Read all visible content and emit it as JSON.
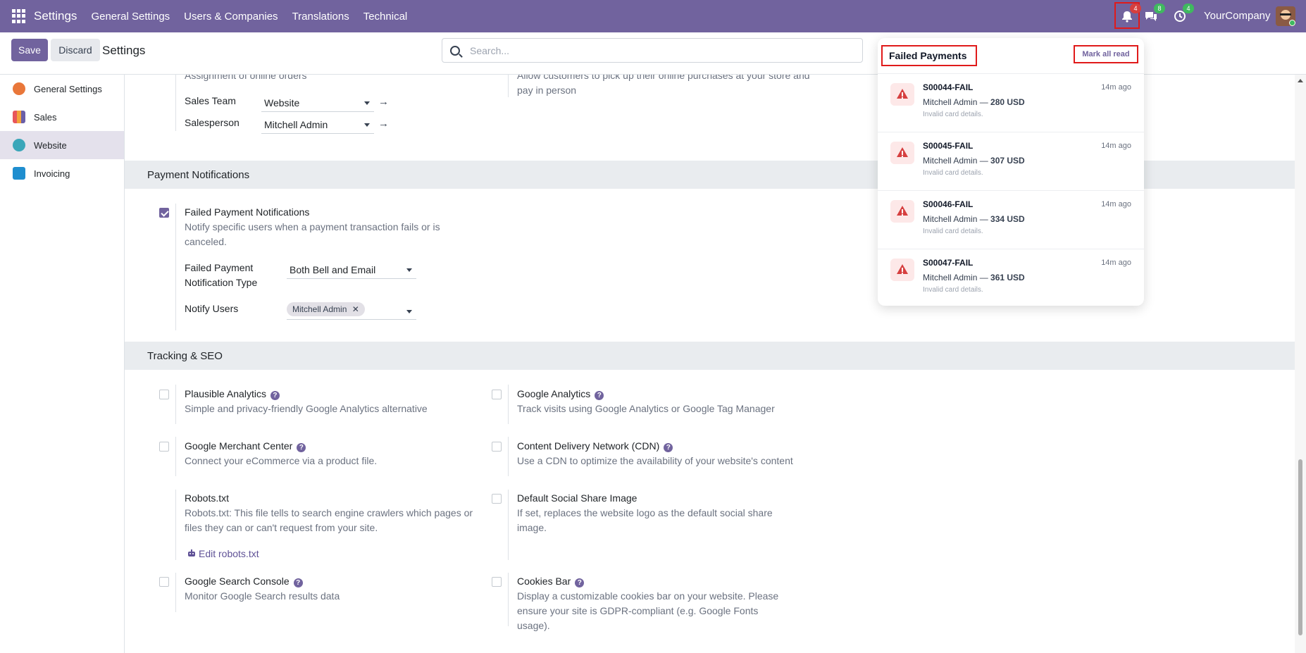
{
  "navbar": {
    "app_title": "Settings",
    "menus": [
      "General Settings",
      "Users & Companies",
      "Translations",
      "Technical"
    ],
    "bell_badge": "4",
    "chat_badge": "8",
    "activity_badge": "4",
    "company": "YourCompany"
  },
  "control": {
    "save_label": "Save",
    "discard_label": "Discard",
    "title": "Settings",
    "search_placeholder": "Search..."
  },
  "sidebar": {
    "items": [
      {
        "label": "General Settings",
        "color": "#e9773a"
      },
      {
        "label": "Sales",
        "color": "#e8565a"
      },
      {
        "label": "Website",
        "color": "#3aa6b9"
      },
      {
        "label": "Invoicing",
        "color": "#1f8ecf"
      }
    ]
  },
  "top_partial": {
    "left_desc": "Assignment of online orders",
    "right_desc": "Allow customers to pick up their online purchases at your store and pay in person",
    "sales_team_label": "Sales Team",
    "sales_team_value": "Website",
    "salesperson_label": "Salesperson",
    "salesperson_value": "Mitchell Admin"
  },
  "payment_notifications": {
    "heading": "Payment Notifications",
    "title": "Failed Payment Notifications",
    "desc": "Notify specific users when a payment transaction fails or is canceled.",
    "checked": true,
    "type_label_1": "Failed Payment",
    "type_label_2": "Notification Type",
    "type_value": "Both Bell and Email",
    "users_label": "Notify Users",
    "users_tag": "Mitchell Admin"
  },
  "tracking_seo": {
    "heading": "Tracking & SEO",
    "settings": [
      {
        "title": "Plausible Analytics",
        "desc": "Simple and privacy-friendly Google Analytics alternative"
      },
      {
        "title": "Google Analytics",
        "desc": "Track visits using Google Analytics or Google Tag Manager"
      },
      {
        "title": "Google Merchant Center",
        "desc": "Connect your eCommerce via a product file."
      },
      {
        "title": "Content Delivery Network (CDN)",
        "desc": "Use a CDN to optimize the availability of your website's content"
      },
      {
        "title": "Robots.txt",
        "desc": "Robots.txt: This file tells to search engine crawlers which pages or files they can or can't request from your site.",
        "link": "Edit robots.txt"
      },
      {
        "title": "Default Social Share Image",
        "desc": "If set, replaces the website logo as the default social share image."
      },
      {
        "title": "Google Search Console",
        "desc": "Monitor Google Search results data"
      },
      {
        "title": "Cookies Bar",
        "desc": "Display a customizable cookies bar on your website. Please ensure your site is GDPR-compliant (e.g. Google Fonts usage)."
      }
    ]
  },
  "dropdown": {
    "title": "Failed Payments",
    "mark_all": "Mark all read",
    "items": [
      {
        "ref": "S00044-FAIL",
        "time": "14m ago",
        "who": "Mitchell Admin — ",
        "amount": "280 USD",
        "reason": "Invalid card details."
      },
      {
        "ref": "S00045-FAIL",
        "time": "14m ago",
        "who": "Mitchell Admin — ",
        "amount": "307 USD",
        "reason": "Invalid card details."
      },
      {
        "ref": "S00046-FAIL",
        "time": "14m ago",
        "who": "Mitchell Admin — ",
        "amount": "334 USD",
        "reason": "Invalid card details."
      },
      {
        "ref": "S00047-FAIL",
        "time": "14m ago",
        "who": "Mitchell Admin — ",
        "amount": "361 USD",
        "reason": "Invalid card details."
      }
    ]
  },
  "help_glyph": "?",
  "close_glyph": "✕",
  "arrow_glyph": "→"
}
